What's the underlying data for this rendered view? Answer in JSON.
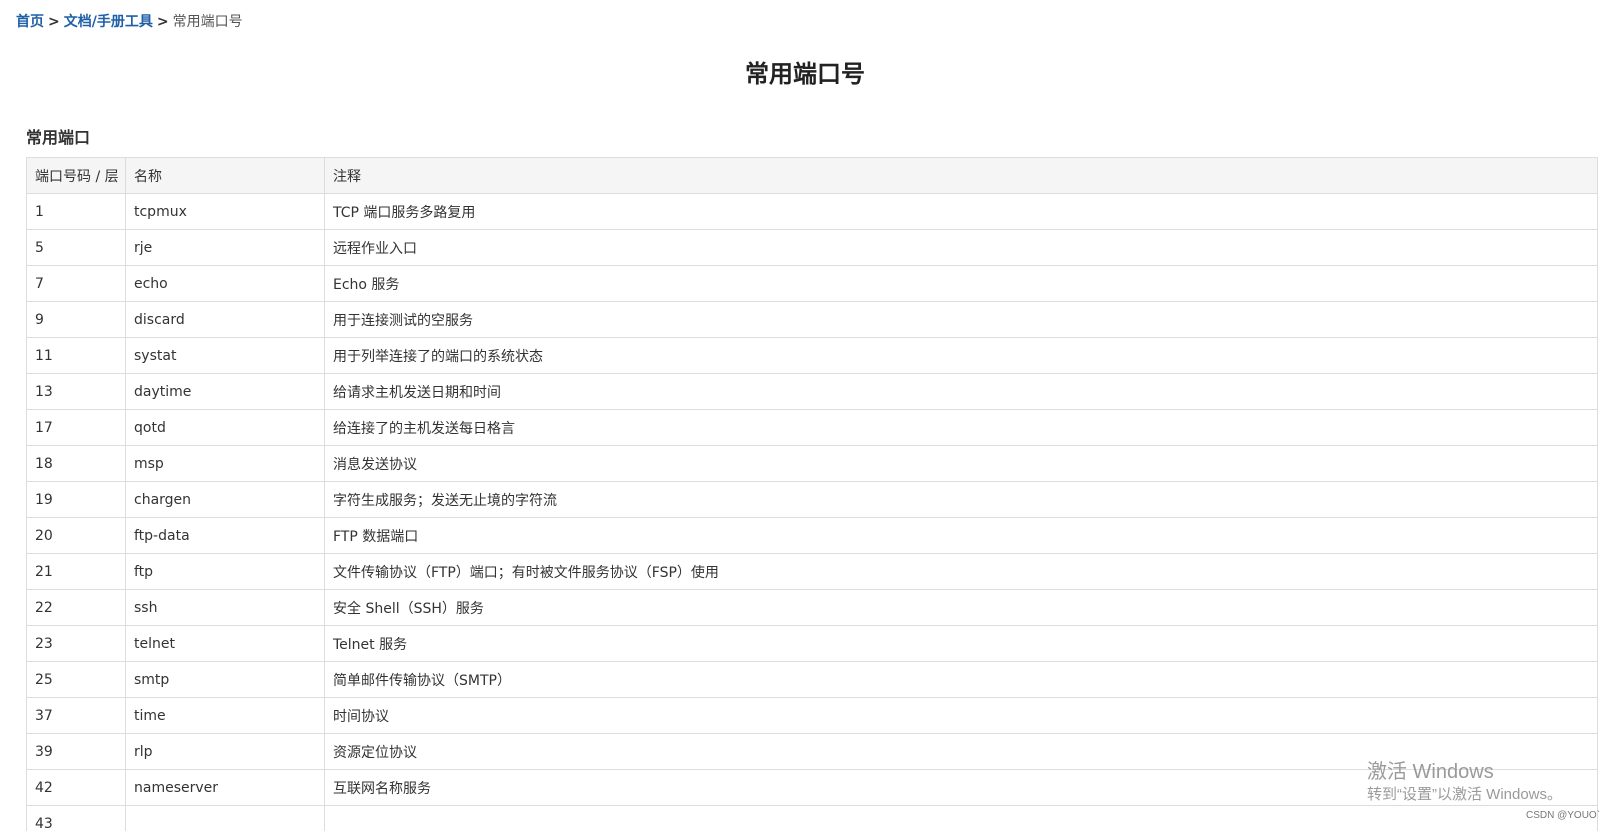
{
  "breadcrumb": {
    "home": "首页",
    "category": "文档/手册工具",
    "separator": ">",
    "current": "常用端口号"
  },
  "title": "常用端口号",
  "section_title": "常用端口",
  "table": {
    "headers": [
      "端口号码 / 层",
      "名称",
      "注释"
    ],
    "rows": [
      [
        "1",
        "tcpmux",
        "TCP 端口服务多路复用"
      ],
      [
        "5",
        "rje",
        "远程作业入口"
      ],
      [
        "7",
        "echo",
        "Echo 服务"
      ],
      [
        "9",
        "discard",
        "用于连接测试的空服务"
      ],
      [
        "11",
        "systat",
        "用于列举连接了的端口的系统状态"
      ],
      [
        "13",
        "daytime",
        "给请求主机发送日期和时间"
      ],
      [
        "17",
        "qotd",
        "给连接了的主机发送每日格言"
      ],
      [
        "18",
        "msp",
        "消息发送协议"
      ],
      [
        "19",
        "chargen",
        "字符生成服务；发送无止境的字符流"
      ],
      [
        "20",
        "ftp-data",
        "FTP 数据端口"
      ],
      [
        "21",
        "ftp",
        "文件传输协议（FTP）端口；有时被文件服务协议（FSP）使用"
      ],
      [
        "22",
        "ssh",
        "安全 Shell（SSH）服务"
      ],
      [
        "23",
        "telnet",
        "Telnet 服务"
      ],
      [
        "25",
        "smtp",
        "简单邮件传输协议（SMTP）"
      ],
      [
        "37",
        "time",
        "时间协议"
      ],
      [
        "39",
        "rlp",
        "资源定位协议"
      ],
      [
        "42",
        "nameserver",
        "互联网名称服务"
      ],
      [
        "43",
        "",
        ""
      ]
    ]
  },
  "watermark": {
    "line1": "激活 Windows",
    "line2": "转到“设置”以激活 Windows。"
  },
  "csdn_mark": "CSDN @YOUO`",
  "colors": {
    "link": "#1f5fa8",
    "header_bg": "#f5f5f5",
    "border": "#dddddd"
  }
}
